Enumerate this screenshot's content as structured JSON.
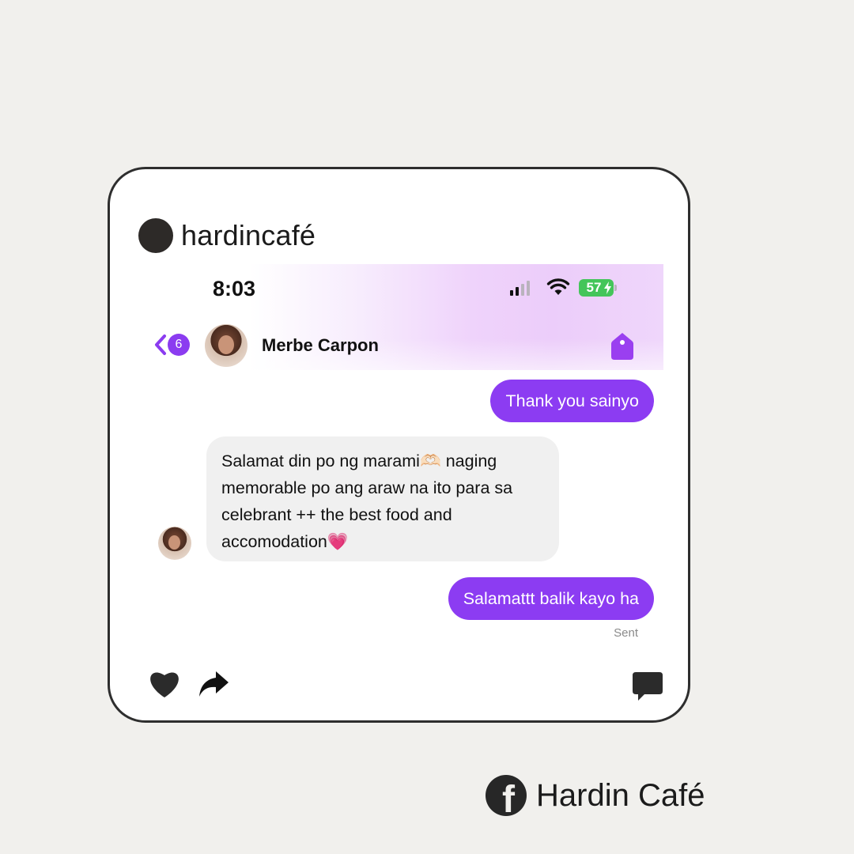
{
  "post": {
    "username": "hardincafé"
  },
  "status_bar": {
    "time": "8:03",
    "battery": "57"
  },
  "chat_header": {
    "back_count": "6",
    "contact_name": "Merbe Carpon"
  },
  "messages": [
    {
      "direction": "outgoing",
      "text": "Thank you sainyo"
    },
    {
      "direction": "incoming",
      "text": "Salamat din po ng marami🫶🏻 naging memorable po ang araw na ito para sa celebrant ++ the best food and accomodation💗"
    },
    {
      "direction": "outgoing",
      "text": "Salamattt balik kayo ha"
    }
  ],
  "sent_label": "Sent",
  "footer": {
    "page_name": "Hardin Café"
  },
  "colors": {
    "accent_purple": "#8c3cf2",
    "incoming_bubble": "#f0f0f0",
    "battery_green": "#44c55a"
  },
  "icons": [
    "back-chevron-icon",
    "signal-icon",
    "wifi-icon",
    "battery-icon",
    "tag-icon",
    "heart-icon",
    "share-icon",
    "comment-icon",
    "facebook-icon"
  ]
}
